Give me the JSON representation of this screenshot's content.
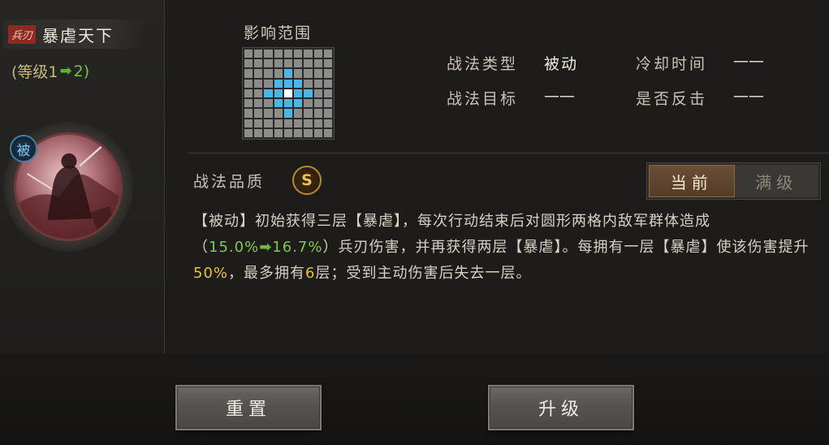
{
  "skill": {
    "weapon_tag": "兵刃",
    "name": "暴虐天下",
    "level_prefix": "(等级1",
    "level_arrow": "➡",
    "level_to": "2)",
    "passive_badge": "被"
  },
  "range": {
    "title": "影响范围"
  },
  "info": {
    "type_label": "战法类型",
    "type_value": "被动",
    "target_label": "战法目标",
    "target_value": "——",
    "cooldown_label": "冷却时间",
    "cooldown_value": "——",
    "counter_label": "是否反击",
    "counter_value": "——"
  },
  "quality": {
    "label": "战法品质",
    "grade": "S"
  },
  "toggle": {
    "current": "当前",
    "max": "满级"
  },
  "description": {
    "p1": "【被动】初始获得三层【暴虐】，每次行动结束后对圆形两格内敌军群体造成（",
    "v1": "15.0%",
    "arrow": "➡",
    "v2": "16.7%",
    "p2": "）兵刃伤害，并再获得两层【暴虐】。每拥有一层【暴虐】使该伤害提升",
    "v3": "50%",
    "p3": "，最多拥有",
    "v4": "6",
    "p4": "层；受到主动伤害后失去一层。"
  },
  "buttons": {
    "reset": "重置",
    "upgrade": "升级"
  },
  "colors": {
    "highlight_yellow": "#e6c232",
    "highlight_green": "#83c84a",
    "range_hit": "#49b6e6"
  },
  "icons": {
    "portrait": "warrior-portrait-icon",
    "arrow": "green-right-arrow-icon"
  }
}
